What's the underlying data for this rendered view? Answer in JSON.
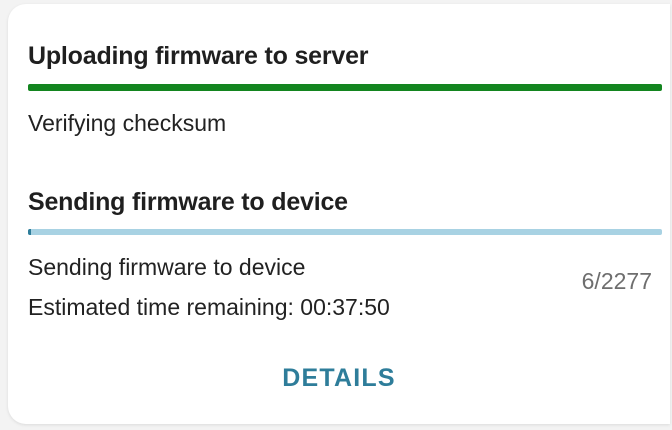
{
  "upload": {
    "title": "Uploading firmware to server",
    "progress": 1.0,
    "status": "Verifying checksum",
    "bar_color": "#13851f"
  },
  "send": {
    "title": "Sending firmware to device",
    "progress": 0.0026,
    "status": "Sending firmware to device",
    "eta": "Estimated time remaining: 00:37:50",
    "counter": "6/2277",
    "bar_color": "#2e7d9a",
    "track_color": "#a8d2e3"
  },
  "actions": {
    "details_label": "DETAILS",
    "accent": "#2e7d9a"
  }
}
